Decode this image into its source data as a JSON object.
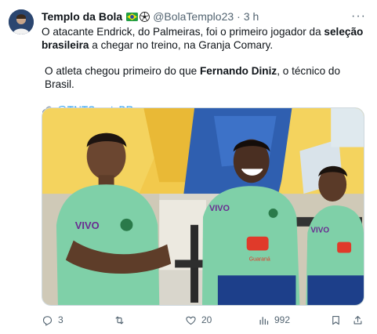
{
  "tweet": {
    "display_name": "Templo da Bola",
    "handle": "@BolaTemplo23",
    "separator": "·",
    "time": "3 h",
    "more_label": "···",
    "text": {
      "p1_pre": "O atacante Endrick, do Palmeiras, foi o primeiro jogador da ",
      "p1_bold": "seleção brasileira",
      "p1_post": " a chegar no treino, na Granja Comary.",
      "p2_pre": "O atleta chegou primeiro do que ",
      "p2_bold": "Fernando Diniz",
      "p2_post": ", o técnico do Brasil.",
      "p3_link": "@TNTSportsBR"
    },
    "media": {
      "jersey_texts": [
        "VIVO",
        "VIVO",
        "VIVO"
      ],
      "sponsor": "Guaraná"
    },
    "actions": {
      "reply_count": "3",
      "retweet_count": "",
      "like_count": "20",
      "views_count": "992"
    }
  },
  "icons": [
    "avatar",
    "brazil-flag-emoji",
    "soccer-ball-emoji",
    "more-icon",
    "link-emoji",
    "reply-icon",
    "retweet-icon",
    "like-icon",
    "views-icon",
    "bookmark-icon",
    "share-icon"
  ],
  "colors": {
    "text": "#0f1419",
    "secondary": "#536471",
    "link": "#1d9bf0",
    "border": "#cfd9de",
    "jersey_green": "#7fd0a8"
  }
}
